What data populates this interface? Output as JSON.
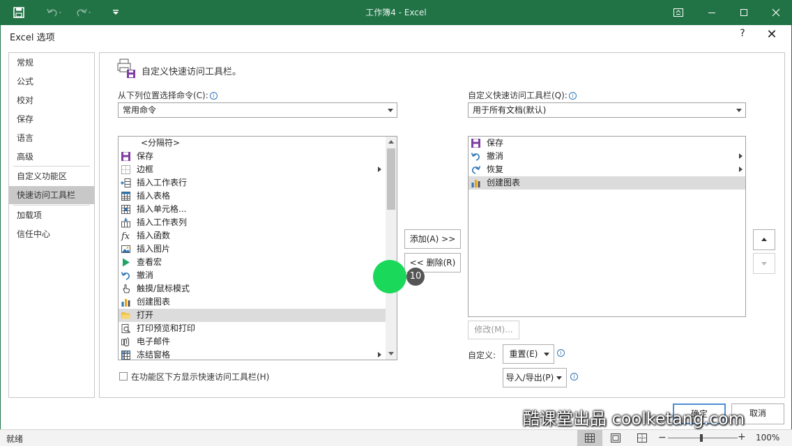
{
  "window": {
    "title": "工作簿4 - Excel"
  },
  "dialog": {
    "title": "Excel 选项",
    "help": "?",
    "close": "✕"
  },
  "nav": [
    {
      "label": "常规"
    },
    {
      "label": "公式"
    },
    {
      "label": "校对"
    },
    {
      "label": "保存"
    },
    {
      "label": "语言"
    },
    {
      "label": "高级"
    },
    {
      "label": "自定义功能区"
    },
    {
      "label": "快速访问工具栏",
      "selected": true
    },
    {
      "label": "加载项"
    },
    {
      "label": "信任中心"
    }
  ],
  "content": {
    "heading": "自定义快速访问工具栏。",
    "choose_label": "从下列位置选择命令(C):",
    "choose_value": "常用命令",
    "customize_label": "自定义快速访问工具栏(Q):",
    "customize_value": "用于所有文档(默认)",
    "commands": [
      {
        "label": "<分隔符>",
        "icon": "separator"
      },
      {
        "label": "保存",
        "icon": "save-icon"
      },
      {
        "label": "边框",
        "icon": "border-icon",
        "submenu": true
      },
      {
        "label": "插入工作表行",
        "icon": "insert-row-icon"
      },
      {
        "label": "插入表格",
        "icon": "insert-table-icon"
      },
      {
        "label": "插入单元格...",
        "icon": "insert-cell-icon"
      },
      {
        "label": "插入工作表列",
        "icon": "insert-column-icon"
      },
      {
        "label": "插入函数",
        "icon": "function-icon"
      },
      {
        "label": "插入图片",
        "icon": "picture-icon"
      },
      {
        "label": "查看宏",
        "icon": "macro-icon"
      },
      {
        "label": "撤消",
        "icon": "undo-icon"
      },
      {
        "label": "触摸/鼠标模式",
        "icon": "touch-icon"
      },
      {
        "label": "创建图表",
        "icon": "chart-icon"
      },
      {
        "label": "打开",
        "icon": "folder-icon",
        "selected": true
      },
      {
        "label": "打印预览和打印",
        "icon": "print-preview-icon"
      },
      {
        "label": "电子邮件",
        "icon": "email-icon"
      },
      {
        "label": "冻结窗格",
        "icon": "freeze-icon",
        "submenu": true
      }
    ],
    "toolbar_items": [
      {
        "label": "保存",
        "icon": "save-icon"
      },
      {
        "label": "撤消",
        "icon": "undo-icon",
        "submenu": true
      },
      {
        "label": "恢复",
        "icon": "redo-icon",
        "submenu": true
      },
      {
        "label": "创建图表",
        "icon": "chart-icon",
        "selected": true
      }
    ],
    "add_button": "添加(A) >>",
    "remove_button": "<< 删除(R)",
    "modify_button": "修改(M)...",
    "custom_label": "自定义:",
    "reset_button": "重置(E)",
    "import_export_button": "导入/导出(P)",
    "show_below_label": "在功能区下方显示快速访问工具栏(H)",
    "ok_button": "确定",
    "cancel_button": "取消"
  },
  "status": {
    "ready": "就绪",
    "zoom": "100%"
  },
  "overlay": {
    "step": "10",
    "watermark": "酷课堂出品 coolketang.com"
  },
  "colors": {
    "excel_green": "#217346",
    "highlight": "#19d85a"
  }
}
